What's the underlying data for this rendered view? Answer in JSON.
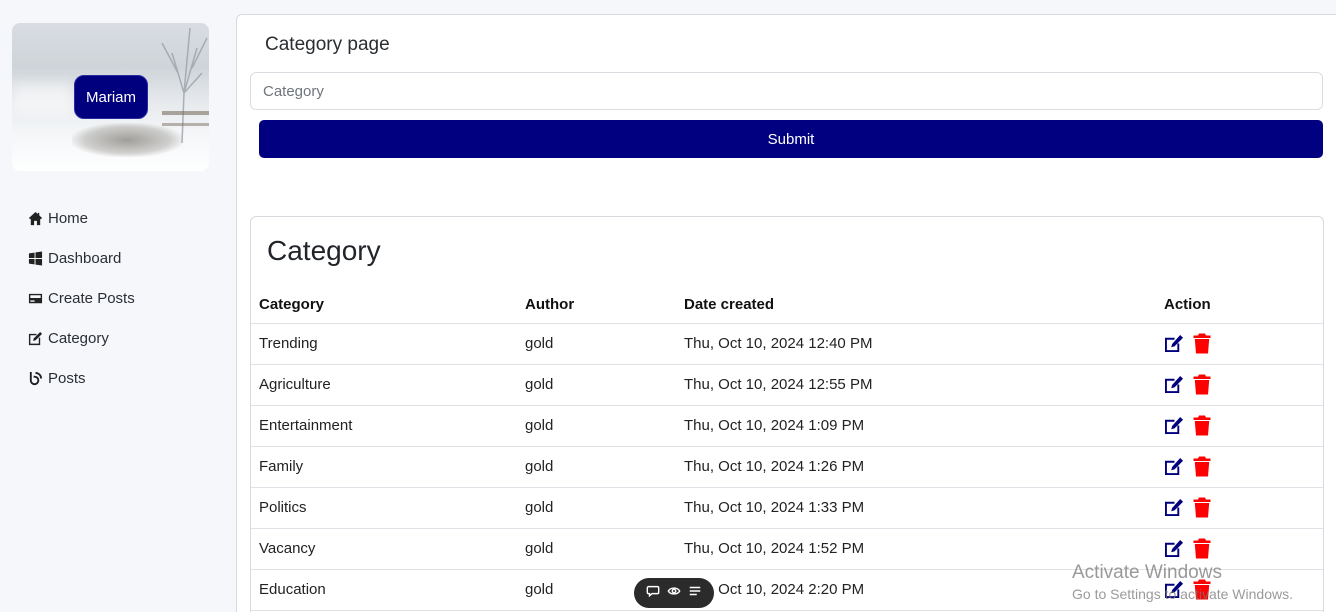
{
  "user": {
    "name": "Mariam"
  },
  "sidebar": {
    "items": [
      {
        "label": "Home",
        "icon": "home-icon"
      },
      {
        "label": "Dashboard",
        "icon": "windows-icon"
      },
      {
        "label": "Create Posts",
        "icon": "card-icon"
      },
      {
        "label": "Category",
        "icon": "edit-square-icon"
      },
      {
        "label": "Posts",
        "icon": "blog-icon"
      }
    ]
  },
  "form": {
    "title": "Category page",
    "placeholder": "Category",
    "submit_label": "Submit"
  },
  "table": {
    "heading": "Category",
    "columns": [
      "Category",
      "Author",
      "Date created",
      "Action"
    ],
    "rows": [
      {
        "category": "Trending",
        "author": "gold",
        "date": "Thu, Oct 10, 2024 12:40 PM"
      },
      {
        "category": "Agriculture",
        "author": "gold",
        "date": "Thu, Oct 10, 2024 12:55 PM"
      },
      {
        "category": "Entertainment",
        "author": "gold",
        "date": "Thu, Oct 10, 2024 1:09 PM"
      },
      {
        "category": "Family",
        "author": "gold",
        "date": "Thu, Oct 10, 2024 1:26 PM"
      },
      {
        "category": "Politics",
        "author": "gold",
        "date": "Thu, Oct 10, 2024 1:33 PM"
      },
      {
        "category": "Vacancy",
        "author": "gold",
        "date": "Thu, Oct 10, 2024 1:52 PM"
      },
      {
        "category": "Education",
        "author": "gold",
        "date": "Thu, Oct 10, 2024 2:20 PM"
      }
    ]
  },
  "colors": {
    "accent": "#000080",
    "delete": "#ff0000"
  },
  "overlay": {
    "activate_title": "Activate Windows",
    "activate_sub": "Go to Settings to activate Windows."
  }
}
